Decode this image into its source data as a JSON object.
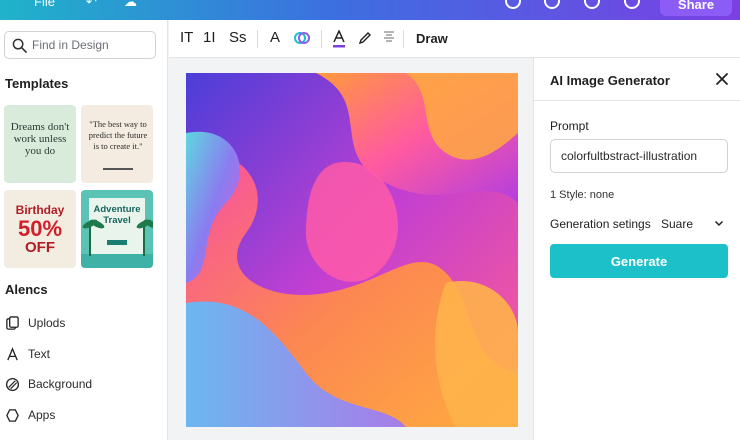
{
  "sidebar": {
    "search_placeholder": "Find in Design",
    "templates_title": "Templates",
    "templates": [
      {
        "text": "Dreams don't work unless you do"
      },
      {
        "text": "\"The best way to predict the future is to create it.\""
      },
      {
        "line1": "Birthday",
        "line2": "50%",
        "line3": "OFF"
      },
      {
        "text": "Adventure Travel"
      }
    ],
    "section2_title": "Alencs",
    "nav": [
      {
        "label": "Uplods",
        "icon": "uploads-icon"
      },
      {
        "label": "Text",
        "icon": "text-icon"
      },
      {
        "label": "Background",
        "icon": "background-icon"
      },
      {
        "label": "Apps",
        "icon": "apps-icon"
      }
    ]
  },
  "toolbar": {
    "items": [
      "IT",
      "1I",
      "Ss",
      "A"
    ],
    "draw_label": "Draw"
  },
  "panel": {
    "title": "AI Image Generator",
    "prompt_label": "Prompt",
    "prompt_value": "colorfultbstract-illustration",
    "style_text": "1 Style: none",
    "generation_label": "Generation setings",
    "generation_value": "Suare",
    "generate_label": "Generate"
  },
  "colors": {
    "accent": "#1cc0c9",
    "topbar_start": "#1fb3c9",
    "topbar_end": "#7b3fe4"
  }
}
